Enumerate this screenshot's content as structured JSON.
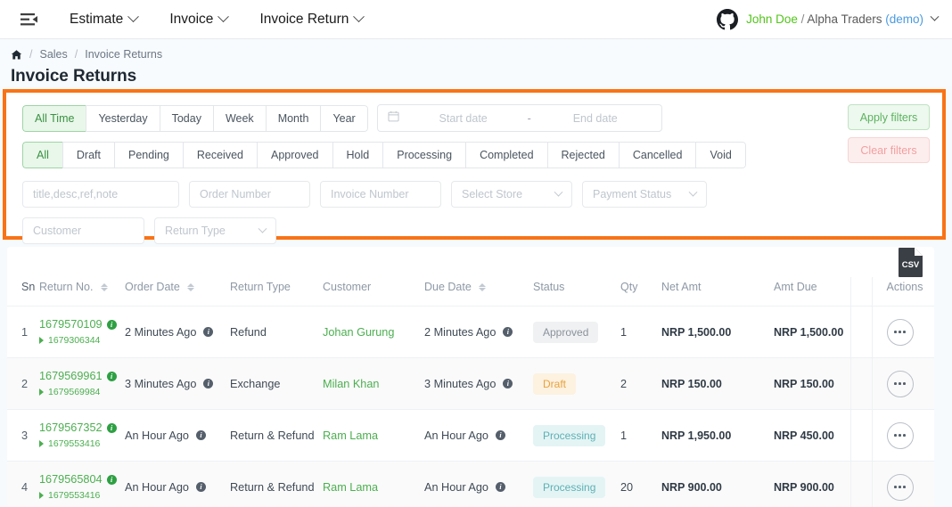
{
  "topnav": {
    "fold_icon": "menu-fold-icon",
    "items": [
      {
        "label": "Estimate"
      },
      {
        "label": "Invoice"
      },
      {
        "label": "Invoice Return"
      }
    ],
    "user": {
      "avatar_icon": "github-avatar-icon",
      "name": "John Doe",
      "separator": "/",
      "org": "Alpha Traders",
      "mode": "(demo)"
    }
  },
  "breadcrumb": {
    "home_icon": "home-icon",
    "sep": "/",
    "parent": "Sales",
    "current": "Invoice Returns"
  },
  "page_title": "Invoice Returns",
  "filters": {
    "highlight_color": "#f97316",
    "time_range": {
      "options": [
        "All Time",
        "Yesterday",
        "Today",
        "Week",
        "Month",
        "Year"
      ],
      "active": "All Time"
    },
    "date_picker": {
      "calendar_icon": "calendar-icon",
      "start_placeholder": "Start date",
      "dash": "-",
      "end_placeholder": "End date",
      "start_value": "",
      "end_value": ""
    },
    "status_tabs": {
      "options": [
        "All",
        "Draft",
        "Pending",
        "Received",
        "Approved",
        "Hold",
        "Processing",
        "Completed",
        "Rejected",
        "Cancelled",
        "Void"
      ],
      "active": "All"
    },
    "fields": [
      {
        "name": "search",
        "placeholder": "title,desc,ref,note",
        "value": "",
        "type": "text"
      },
      {
        "name": "order-number",
        "placeholder": "Order Number",
        "value": "",
        "type": "text"
      },
      {
        "name": "invoice-number",
        "placeholder": "Invoice Number",
        "value": "",
        "type": "text"
      },
      {
        "name": "store",
        "placeholder": "Select Store",
        "value": "",
        "type": "select"
      },
      {
        "name": "payment-status",
        "placeholder": "Payment Status",
        "value": "",
        "type": "select"
      },
      {
        "name": "customer",
        "placeholder": "Customer",
        "value": "",
        "type": "text"
      },
      {
        "name": "return-type",
        "placeholder": "Return Type",
        "value": "",
        "type": "select"
      }
    ],
    "apply_label": "Apply filters",
    "clear_label": "Clear filters"
  },
  "export": {
    "icon": "csv-file-icon",
    "label": "CSV"
  },
  "table": {
    "columns": [
      {
        "key": "sn",
        "label": "Sn",
        "sortable": false
      },
      {
        "key": "return_no",
        "label": "Return No.",
        "sortable": true
      },
      {
        "key": "order_date",
        "label": "Order Date",
        "sortable": true
      },
      {
        "key": "return_type",
        "label": "Return Type",
        "sortable": false
      },
      {
        "key": "customer",
        "label": "Customer",
        "sortable": false
      },
      {
        "key": "due_date",
        "label": "Due Date",
        "sortable": true
      },
      {
        "key": "status",
        "label": "Status",
        "sortable": false
      },
      {
        "key": "qty",
        "label": "Qty",
        "sortable": false
      },
      {
        "key": "net_amt",
        "label": "Net Amt",
        "sortable": false
      },
      {
        "key": "amt_due",
        "label": "Amt Due",
        "sortable": false
      },
      {
        "key": "actions",
        "label": "Actions",
        "sortable": false
      }
    ],
    "rows": [
      {
        "sn": "1",
        "return_no": "1679570109",
        "return_ref": "1679306344",
        "order_date": "2 Minutes Ago",
        "return_type": "Refund",
        "customer": "Johan Gurung",
        "due_date": "2 Minutes Ago",
        "status": "Approved",
        "status_style": "b-approved",
        "qty": "1",
        "net_amt": "NRP 1,500.00",
        "amt_due": "NRP 1,500.00"
      },
      {
        "sn": "2",
        "return_no": "1679569961",
        "return_ref": "1679569984",
        "order_date": "3 Minutes Ago",
        "return_type": "Exchange",
        "customer": "Milan Khan",
        "due_date": "3 Minutes Ago",
        "status": "Draft",
        "status_style": "b-draft",
        "qty": "2",
        "net_amt": "NRP 150.00",
        "amt_due": "NRP 150.00"
      },
      {
        "sn": "3",
        "return_no": "1679567352",
        "return_ref": "1679553416",
        "order_date": "An Hour Ago",
        "return_type": "Return & Refund",
        "customer": "Ram Lama",
        "due_date": "An Hour Ago",
        "status": "Processing",
        "status_style": "b-processing",
        "qty": "1",
        "net_amt": "NRP 1,950.00",
        "amt_due": "NRP 450.00"
      },
      {
        "sn": "4",
        "return_no": "1679565804",
        "return_ref": "1679553416",
        "order_date": "An Hour Ago",
        "return_type": "Return & Refund",
        "customer": "Ram Lama",
        "due_date": "An Hour Ago",
        "status": "Processing",
        "status_style": "b-processing",
        "qty": "20",
        "net_amt": "NRP 900.00",
        "amt_due": "NRP 900.00"
      }
    ]
  }
}
